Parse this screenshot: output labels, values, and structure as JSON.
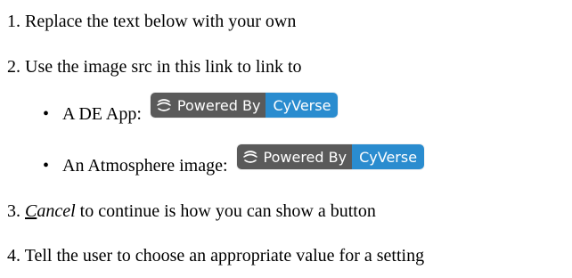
{
  "list": {
    "item1": {
      "number": "1.",
      "text": "Replace the text below with your own"
    },
    "item2": {
      "number": "2.",
      "text": "Use the image src in this link to link to",
      "bullets": [
        {
          "text": "A DE App:",
          "badge": {
            "left": "Powered By",
            "right": "CyVerse"
          }
        },
        {
          "text": "An Atmosphere image:",
          "badge": {
            "left": "Powered By",
            "right": "CyVerse"
          }
        }
      ]
    },
    "item3": {
      "number": "3.",
      "cancel_first_letter": "C",
      "cancel_rest": "ancel",
      "text_after": " to continue is how you can show a button"
    },
    "item4": {
      "number": "4.",
      "text": "Tell the user to choose an appropriate value for a setting"
    }
  },
  "colors": {
    "badge_left_bg": "#5a5a5a",
    "badge_right_bg": "#2a8ccf",
    "badge_text": "#ffffff"
  },
  "icons": {
    "badge_logo": "cyverse-logo-icon"
  }
}
